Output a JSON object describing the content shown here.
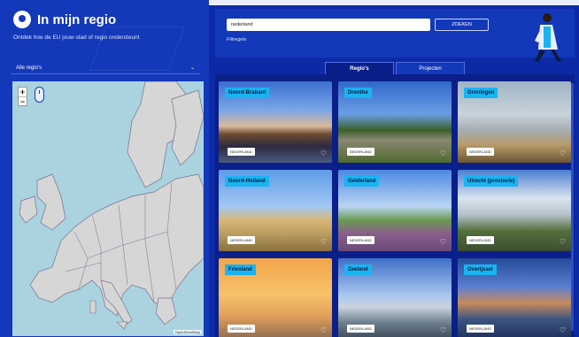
{
  "header": {
    "title": "In mijn regio",
    "subtitle": "Ontdek hoe de EU jouw stad of regio ondersteunt"
  },
  "sidebar": {
    "region_select": "Alle regio's"
  },
  "map": {
    "zoom_in": "+",
    "zoom_out": "−",
    "attribution": "OpenStreetMap"
  },
  "search": {
    "value": "nederland",
    "button": "ZOEKEN",
    "filter_link": "Filtregels"
  },
  "tabs": [
    {
      "label": "Regio's",
      "active": true
    },
    {
      "label": "Projecten",
      "active": false
    }
  ],
  "cards": [
    {
      "title": "Noord-Brabant",
      "badge": "NEDERLAND"
    },
    {
      "title": "Drenthe",
      "badge": "NEDERLAND"
    },
    {
      "title": "Groningen",
      "badge": "NEDERLAND"
    },
    {
      "title": "Noord-Holland",
      "badge": "NEDERLAND"
    },
    {
      "title": "Gelderland",
      "badge": "NEDERLAND"
    },
    {
      "title": "Utrecht (provincie)",
      "badge": "NEDERLAND"
    },
    {
      "title": "Friesland",
      "badge": "NEDERLAND"
    },
    {
      "title": "Zeeland",
      "badge": "NEDERLAND"
    },
    {
      "title": "Overijssel",
      "badge": "NEDERLAND"
    }
  ],
  "colors": {
    "primary": "#1338b9",
    "dark": "#0b1f8a",
    "label": "#19b4f1",
    "sea": "#aad3df",
    "land": "#d6d6d6"
  }
}
